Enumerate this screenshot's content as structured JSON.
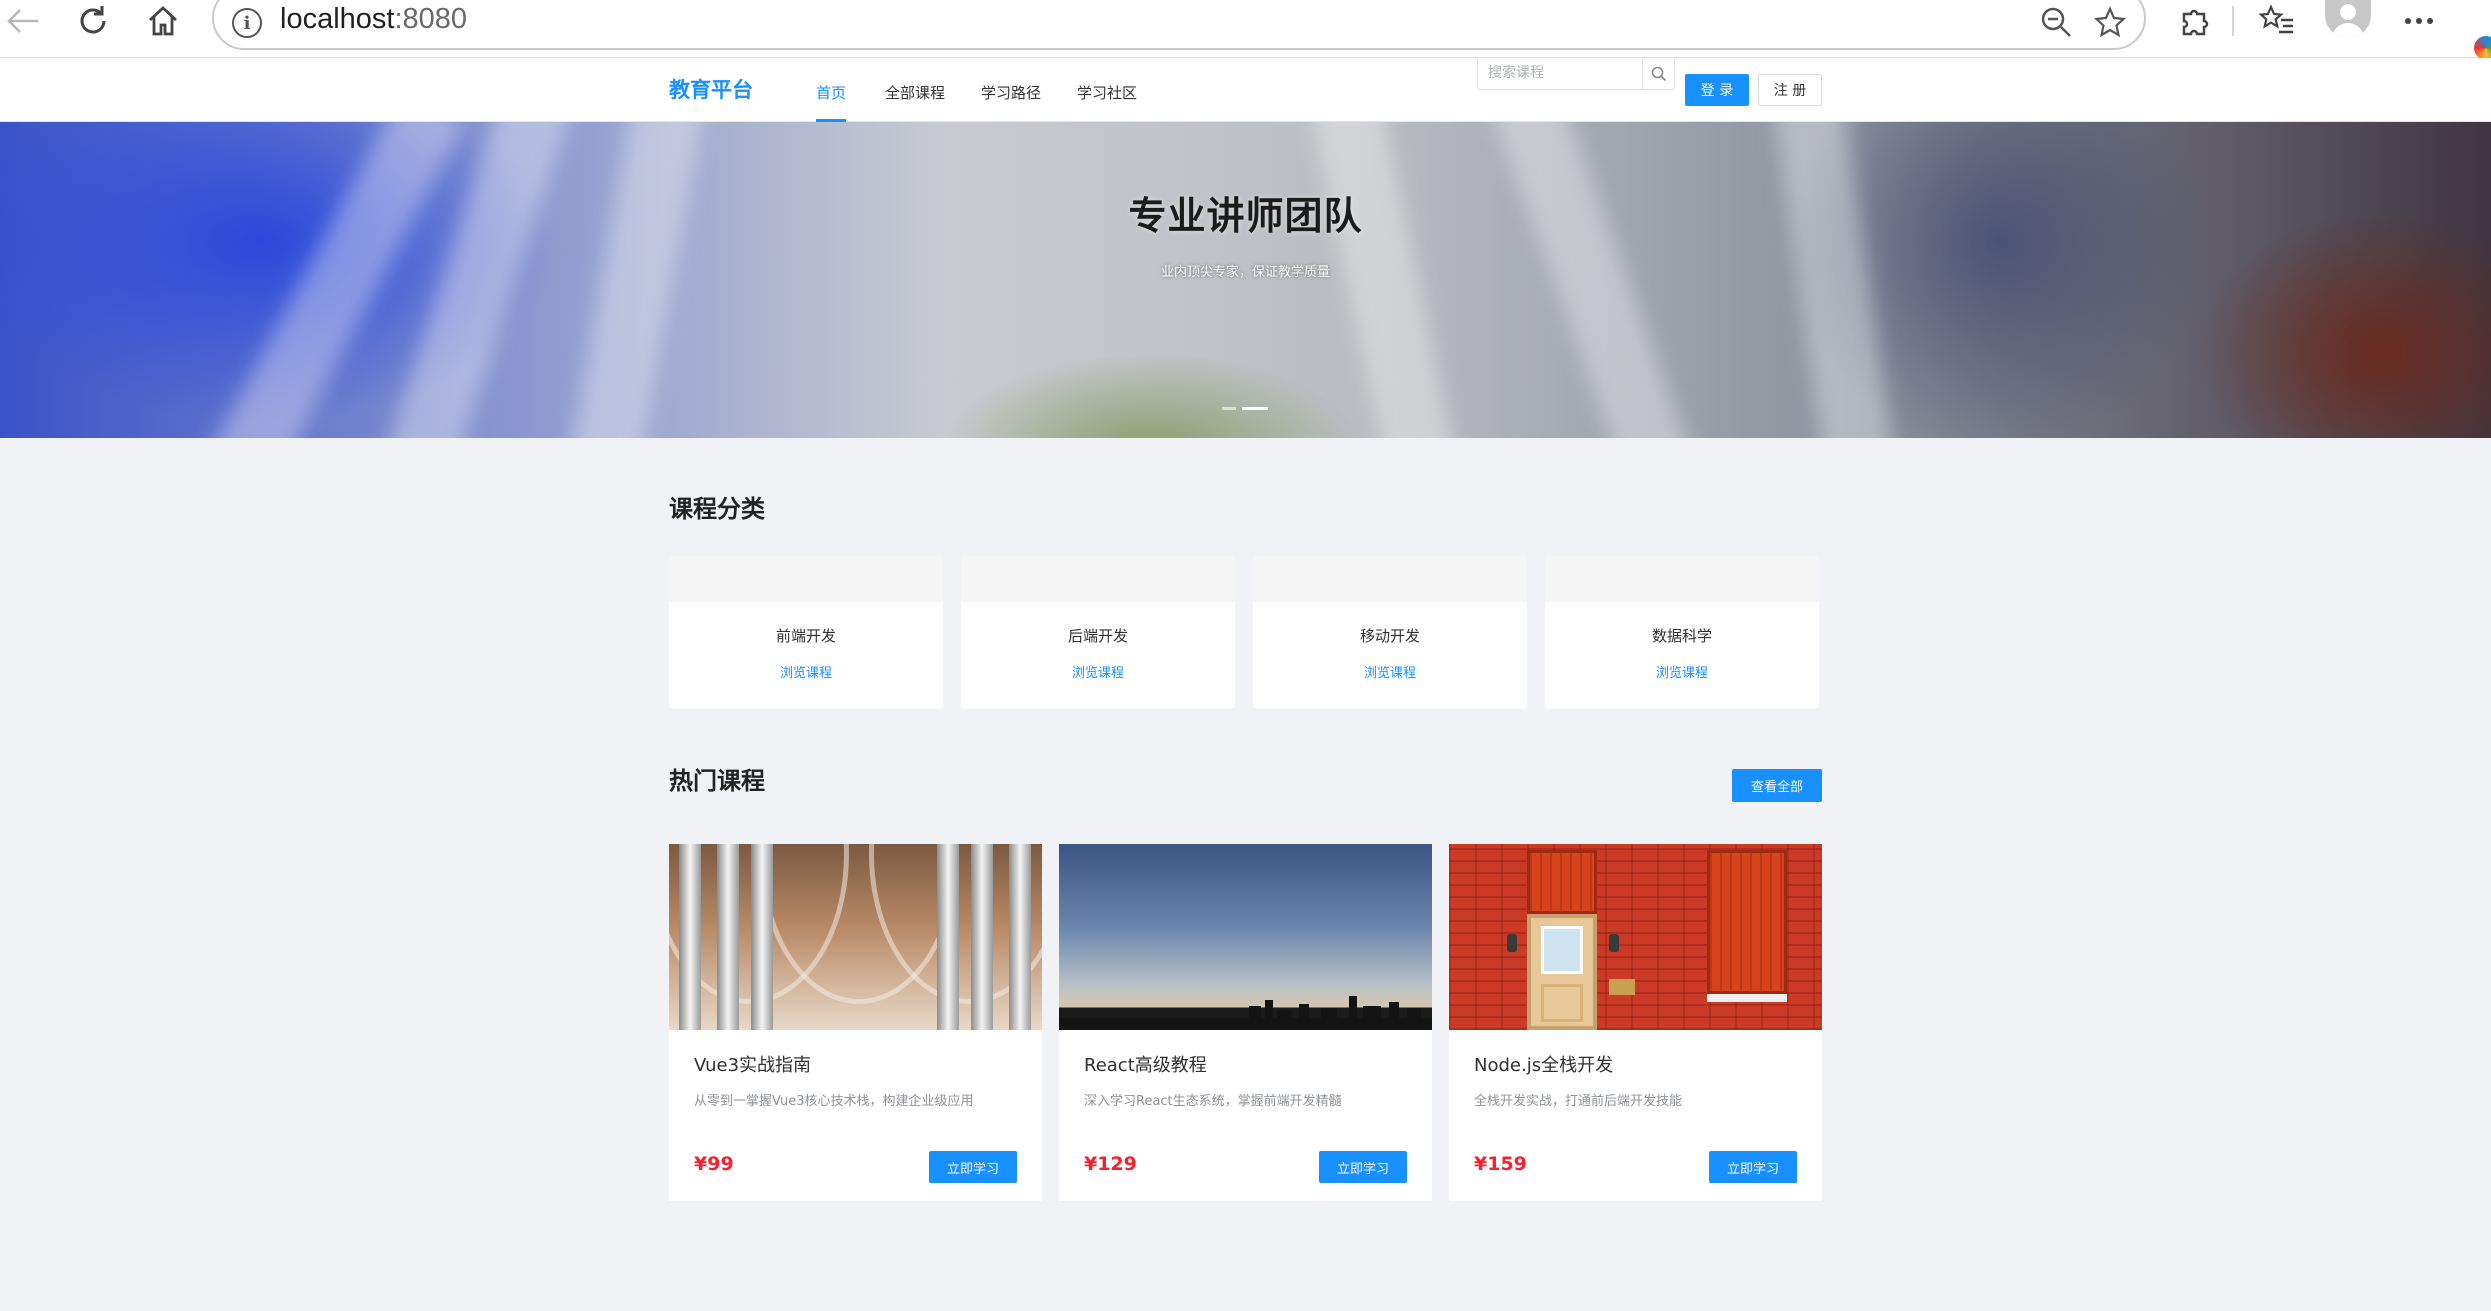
{
  "browser": {
    "url_host": "localhost",
    "url_port": ":8080",
    "icons": {
      "back": "back-arrow-icon",
      "refresh": "refresh-icon",
      "home": "home-icon",
      "info": "info-icon",
      "zoom": "zoom-out-icon",
      "favorite": "star-icon",
      "extensions": "puzzle-icon",
      "favorites_list": "favorites-icon",
      "profile": "profile-icon",
      "more": "more-icon"
    }
  },
  "header": {
    "logo": "教育平台",
    "nav": [
      {
        "label": "首页",
        "active": true
      },
      {
        "label": "全部课程",
        "active": false
      },
      {
        "label": "学习路径",
        "active": false
      },
      {
        "label": "学习社区",
        "active": false
      }
    ],
    "search_placeholder": "搜索课程",
    "login": "登 录",
    "register": "注 册"
  },
  "banner": {
    "title": "专业讲师团队",
    "subtitle": "业内顶尖专家，保证教学质量",
    "slides": 2,
    "active_slide": 1
  },
  "categories": {
    "title": "课程分类",
    "items": [
      {
        "name": "前端开发",
        "link": "浏览课程"
      },
      {
        "name": "后端开发",
        "link": "浏览课程"
      },
      {
        "name": "移动开发",
        "link": "浏览课程"
      },
      {
        "name": "数据科学",
        "link": "浏览课程"
      }
    ]
  },
  "hot": {
    "title": "热门课程",
    "view_all": "查看全部",
    "courses": [
      {
        "title": "Vue3实战指南",
        "desc": "从零到一掌握Vue3核心技术栈，构建企业级应用",
        "price": "¥99",
        "button": "立即学习"
      },
      {
        "title": "React高级教程",
        "desc": "深入学习React生态系统，掌握前端开发精髓",
        "price": "¥129",
        "button": "立即学习"
      },
      {
        "title": "Node.js全栈开发",
        "desc": "全栈开发实战，打通前后端开发技能",
        "price": "¥159",
        "button": "立即学习"
      }
    ]
  },
  "colors": {
    "primary": "#1890ff",
    "price": "#f5222d",
    "page_bg": "#f0f2f5"
  }
}
